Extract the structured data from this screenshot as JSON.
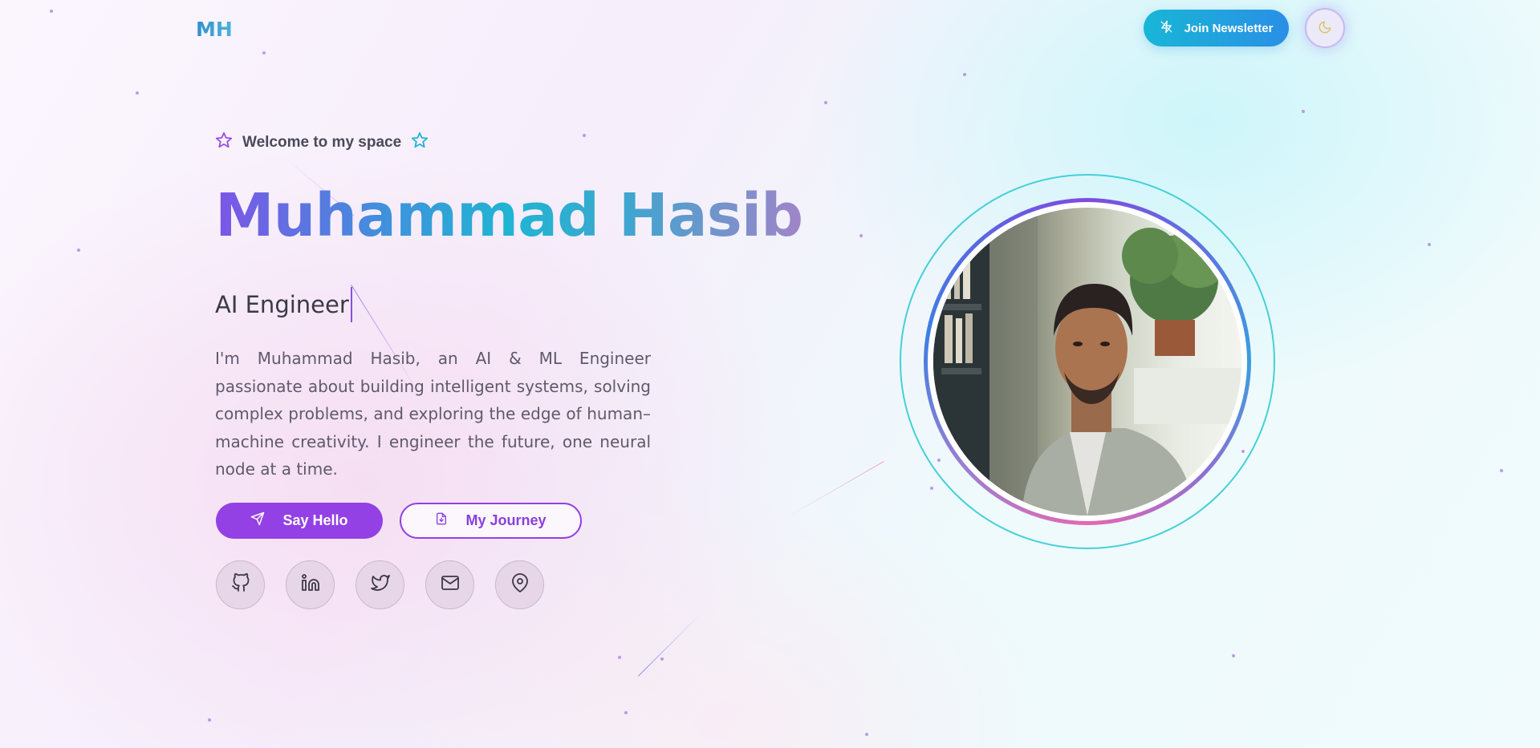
{
  "header": {
    "logo": "MH",
    "newsletter_label": "Join Newsletter",
    "newsletter_icon": "zap-icon",
    "theme_icon": "moon-icon"
  },
  "hero": {
    "welcome": "Welcome to my space",
    "name": "Muhammad Hasib",
    "role": "AI Engineer",
    "bio": "I'm Muhammad Hasib, an AI & ML Engineer passionate about building intelligent systems, solving complex problems, and exploring the edge of human–machine creativity. I engineer the future, one neural node at a time.",
    "buttons": {
      "say_hello": "Say Hello",
      "journey": "My Journey"
    },
    "socials": [
      "github-icon",
      "linkedin-icon",
      "twitter-icon",
      "mail-icon",
      "map-pin-icon"
    ]
  },
  "colors": {
    "accent_purple": "#9340e4",
    "accent_cyan": "#1fb5d2",
    "ring_cyan": "#45d0d8"
  }
}
